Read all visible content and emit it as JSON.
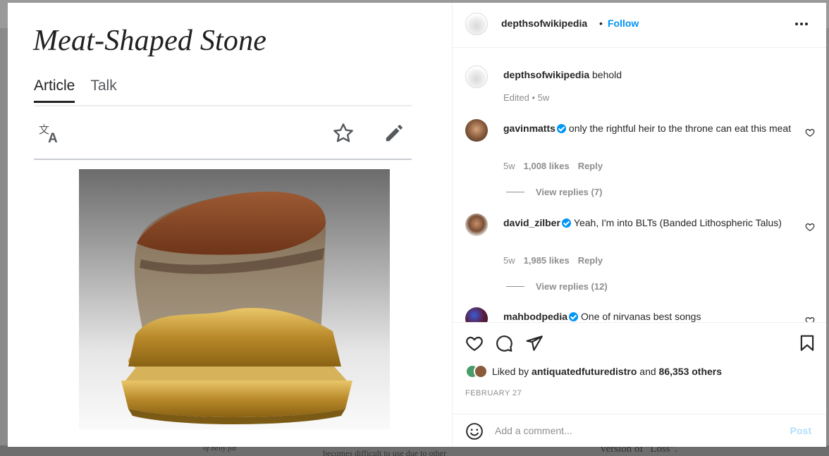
{
  "backdrop": {
    "bottom_left_text": "of belly fat",
    "bottom_center_text": "becomes difficult to use due to other",
    "bottom_right_text": "version of \"Loss\"."
  },
  "article": {
    "title": "Meat-Shaped Stone",
    "tabs": [
      {
        "label": "Article",
        "active": true
      },
      {
        "label": "Talk",
        "active": false
      }
    ],
    "tools": {
      "language_icon": "translate-icon",
      "watch_icon": "star-icon",
      "edit_icon": "pencil-icon"
    },
    "image_alt": "Meat-shaped stone on a gold stand"
  },
  "post": {
    "author": "depthsofwikipedia",
    "separator": "•",
    "follow_label": "Follow",
    "more_icon": "more-options-icon",
    "caption": {
      "username": "depthsofwikipedia",
      "text": "behold",
      "meta": "Edited • 5w"
    },
    "comments": [
      {
        "username": "gavinmatts",
        "verified": true,
        "text": "only the rightful heir to the throne can eat this meat",
        "age": "5w",
        "likes": "1,008 likes",
        "reply_label": "Reply",
        "view_replies": "View replies (7)"
      },
      {
        "username": "david_zilber",
        "verified": true,
        "text": "Yeah, I'm into BLTs (Banded Lithospheric Talus)",
        "age": "5w",
        "likes": "1,985 likes",
        "reply_label": "Reply",
        "view_replies": "View replies (12)"
      },
      {
        "username": "mahbodpedia",
        "verified": true,
        "text": "One of nirvanas best songs"
      }
    ],
    "liked_by_prefix": "Liked by",
    "liked_by_user": "antiquatedfuturedistro",
    "liked_by_and": "and",
    "liked_by_others": "86,353 others",
    "date": "FEBRUARY 27",
    "add_comment_placeholder": "Add a comment...",
    "post_button": "Post",
    "colors": {
      "accent": "#0095f6",
      "verified": "#0095f6",
      "post_disabled": "#b2dffc"
    }
  }
}
